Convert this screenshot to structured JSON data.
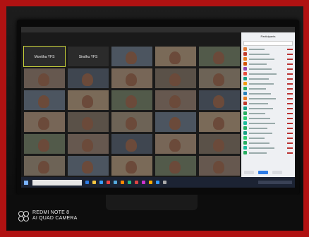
{
  "watermark": {
    "device": "REDMI NOTE 8",
    "camera": "AI QUAD CAMERA"
  },
  "gallery": {
    "tiles": [
      {
        "name": "Monitha YFS",
        "type": "dark",
        "active": true
      },
      {
        "name": "Sindhu YFS",
        "type": "dark",
        "active": false
      },
      {
        "name": "",
        "type": "video"
      },
      {
        "name": "",
        "type": "video"
      },
      {
        "name": "",
        "type": "video"
      },
      {
        "name": "",
        "type": "video"
      },
      {
        "name": "",
        "type": "video"
      },
      {
        "name": "",
        "type": "video"
      },
      {
        "name": "",
        "type": "video"
      },
      {
        "name": "",
        "type": "video"
      },
      {
        "name": "",
        "type": "video"
      },
      {
        "name": "",
        "type": "video"
      },
      {
        "name": "",
        "type": "video"
      },
      {
        "name": "",
        "type": "video"
      },
      {
        "name": "",
        "type": "video"
      },
      {
        "name": "",
        "type": "video"
      },
      {
        "name": "",
        "type": "video"
      },
      {
        "name": "",
        "type": "video"
      },
      {
        "name": "",
        "type": "video"
      },
      {
        "name": "",
        "type": "video"
      },
      {
        "name": "",
        "type": "video"
      },
      {
        "name": "",
        "type": "video"
      },
      {
        "name": "",
        "type": "video"
      },
      {
        "name": "",
        "type": "video"
      },
      {
        "name": "",
        "type": "video"
      },
      {
        "name": "",
        "type": "video"
      },
      {
        "name": "",
        "type": "video"
      },
      {
        "name": "",
        "type": "video"
      },
      {
        "name": "",
        "type": "video"
      },
      {
        "name": "",
        "type": "video"
      }
    ]
  },
  "participants": {
    "title": "Participants",
    "rows": 22,
    "avatar_colors": [
      "#e07b39",
      "#c0392b",
      "#e67e22",
      "#d35400",
      "#8e44ad",
      "#e74c3c",
      "#16a085",
      "#f39c12",
      "#27ae60",
      "#2980b9",
      "#e67e22",
      "#c0392b",
      "#16a085",
      "#27ae60",
      "#2ecc71",
      "#1abc9c",
      "#27ae60",
      "#16a085",
      "#2ecc71",
      "#27ae60",
      "#1abc9c",
      "#27ae60"
    ]
  },
  "taskbar": {
    "icon_colors": [
      "#2d7be5",
      "#f5c542",
      "#3aa0ff",
      "#e44",
      "#5ad",
      "#f80",
      "#2b8",
      "#d44",
      "#c3c",
      "#fa0",
      "#39f",
      "#aaa"
    ]
  }
}
